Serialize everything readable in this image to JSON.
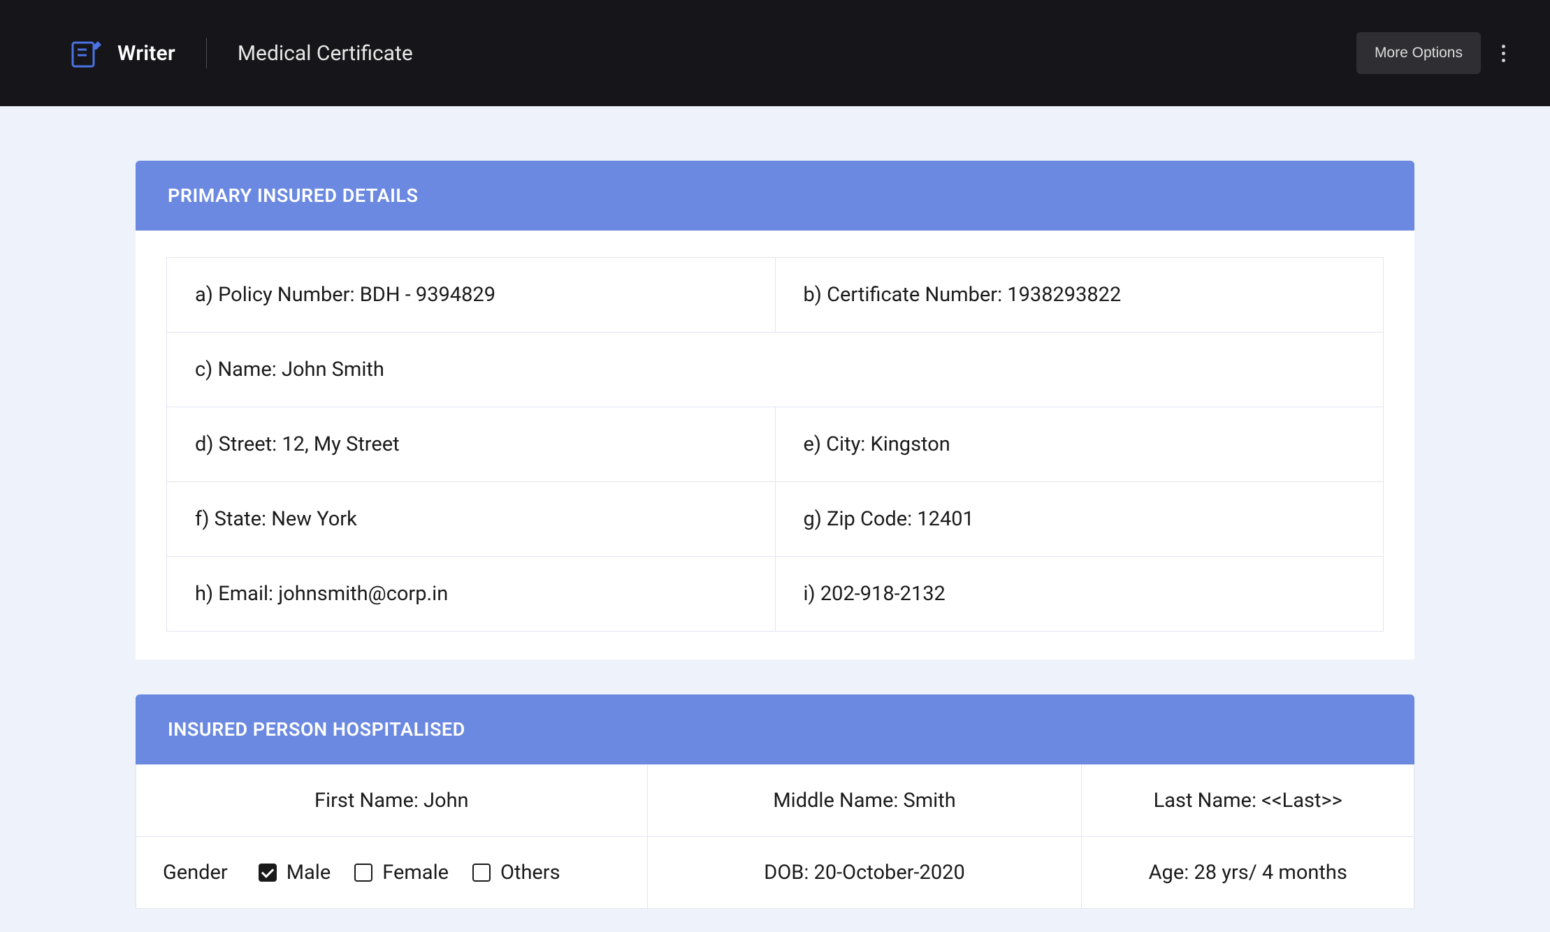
{
  "header": {
    "app_name": "Writer",
    "doc_title": "Medical Certificate",
    "more_options_label": "More Options"
  },
  "section1": {
    "title": "PRIMARY INSURED DETAILS",
    "rows": {
      "policy": "a) Policy Number: BDH - 9394829",
      "certificate": "b) Certificate Number: 1938293822",
      "name": "c) Name: John Smith",
      "street": "d) Street: 12, My Street",
      "city": "e) City: Kingston",
      "state": "f) State: New York",
      "zip": "g) Zip Code: 12401",
      "email": "h) Email: johnsmith@corp.in",
      "phone": "i) 202-918-2132"
    }
  },
  "section2": {
    "title": "INSURED PERSON HOSPITALISED",
    "first_name": "First Name: John",
    "middle_name": "Middle Name: Smith",
    "last_name": "Last Name: <<Last>>",
    "gender_label": "Gender",
    "gender_options": {
      "male": "Male",
      "female": "Female",
      "others": "Others"
    },
    "gender_checked": "male",
    "dob": "DOB: 20-October-2020",
    "age": "Age: 28 yrs/ 4 months"
  }
}
